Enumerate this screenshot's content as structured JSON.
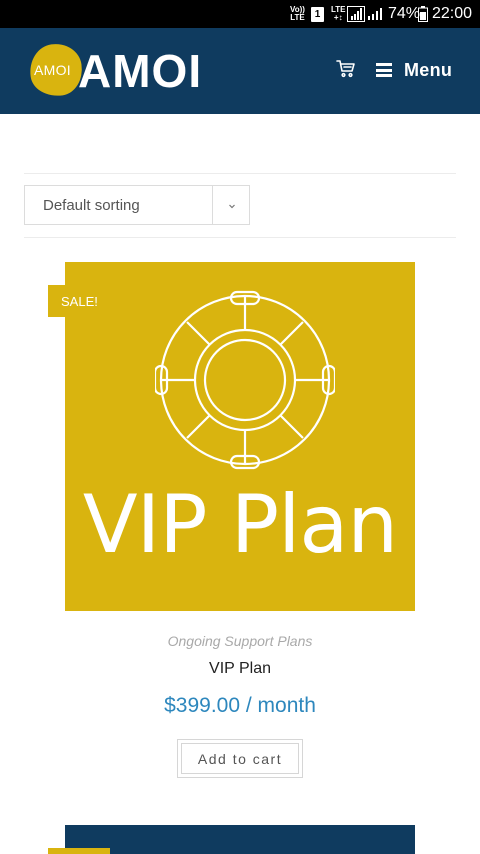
{
  "status_bar": {
    "volte_line1": "Vo))",
    "volte_line2": "LTE",
    "sim": "1",
    "lte_line1": "LTE",
    "lte_line2": "+↕",
    "battery_percent": "74%",
    "time": "22:00"
  },
  "header": {
    "logo_small": "AMOI",
    "logo_big": "AMOI",
    "menu_label": "Menu",
    "colors": {
      "background": "#0f3b5f",
      "accent": "#d9b40f"
    }
  },
  "sorting": {
    "selected": "Default sorting"
  },
  "product": {
    "badge": "SALE!",
    "image_text": "VIP Plan",
    "category": "Ongoing Support Plans",
    "title": "VIP Plan",
    "price": "$399.00 / month",
    "add_to_cart_label": "Add to cart",
    "colors": {
      "image_bg": "#d9b40f",
      "price": "#2d87bd"
    }
  },
  "icons": [
    "cart-icon",
    "menu-icon",
    "chevron-down-icon",
    "lifebuoy-icon",
    "signal-icon",
    "battery-icon"
  ]
}
